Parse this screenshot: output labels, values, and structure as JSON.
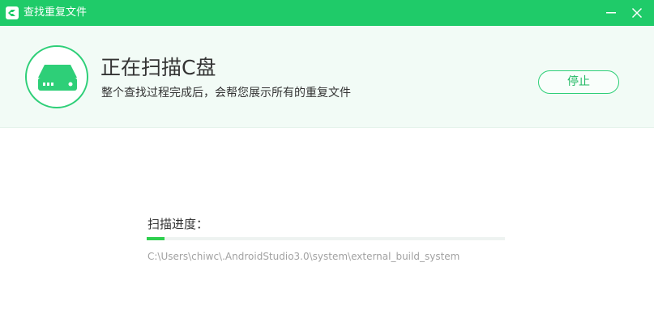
{
  "window": {
    "title": "查找重复文件",
    "icon": "app-logo-icon",
    "controls": {
      "minimize_icon": "minimize-icon",
      "close_icon": "close-icon"
    }
  },
  "header": {
    "icon": "hard-disk-icon",
    "title": "正在扫描C盘",
    "subtitle": "整个查找过程完成后，会帮您展示所有的重复文件",
    "stop_button": "停止"
  },
  "progress": {
    "label": "扫描进度：",
    "percent": 5,
    "current_path": "C:\\Users\\chiwc\\.AndroidStudio3.0\\system\\external_build_system"
  },
  "colors": {
    "accent": "#1fcb69",
    "accent_border": "#2ecf78",
    "progress": "#2ecf4e",
    "text": "#333333",
    "muted": "#a2a2a2"
  }
}
